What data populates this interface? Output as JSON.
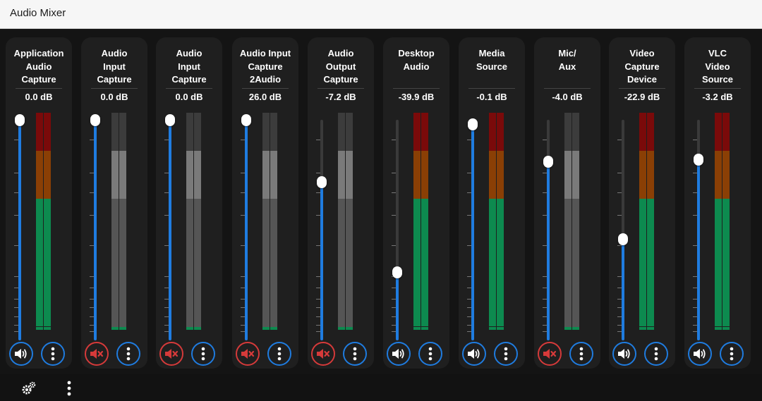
{
  "window": {
    "title": "Audio Mixer"
  },
  "strips": [
    {
      "name": "Application\nAudio\nCapture",
      "db": "0.0 dB",
      "level": 1.0,
      "muted": false,
      "meter": "active"
    },
    {
      "name": "Audio\nInput\nCapture",
      "db": "0.0 dB",
      "level": 1.0,
      "muted": true,
      "meter": "muted"
    },
    {
      "name": "Audio\nInput\nCapture",
      "db": "0.0 dB",
      "level": 1.0,
      "muted": true,
      "meter": "muted"
    },
    {
      "name": "Audio Input\nCapture\n2Audio",
      "db": "26.0 dB",
      "level": 1.0,
      "muted": true,
      "meter": "muted"
    },
    {
      "name": "Audio\nOutput\nCapture",
      "db": "-7.2 dB",
      "level": 0.72,
      "muted": true,
      "meter": "muted"
    },
    {
      "name": "Desktop\nAudio",
      "db": "-39.9 dB",
      "level": 0.31,
      "muted": false,
      "meter": "active"
    },
    {
      "name": "Media\nSource",
      "db": "-0.1 dB",
      "level": 0.98,
      "muted": false,
      "meter": "active"
    },
    {
      "name": "Mic/\nAux",
      "db": "-4.0 dB",
      "level": 0.81,
      "muted": true,
      "meter": "muted"
    },
    {
      "name": "Video\nCapture\nDevice",
      "db": "-22.9 dB",
      "level": 0.46,
      "muted": false,
      "meter": "active"
    },
    {
      "name": "VLC\nVideo\nSource",
      "db": "-3.2 dB",
      "level": 0.82,
      "muted": false,
      "meter": "active"
    }
  ],
  "icons": {
    "mute": "speaker-icon",
    "muted": "speaker-muted-icon",
    "menu": "vertical-ellipsis-icon",
    "settings": "gears-icon"
  },
  "colors": {
    "accent": "#1f7ce0",
    "muted": "#d63a3a",
    "meter_green": "#0d8a4f",
    "meter_orange": "#8a3f05",
    "meter_red": "#7a0a0a"
  }
}
